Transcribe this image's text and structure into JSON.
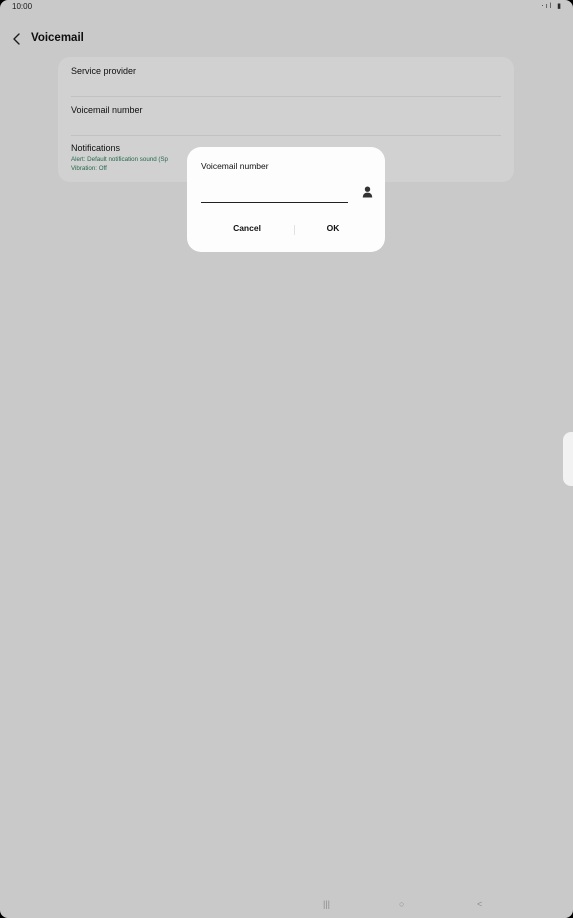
{
  "status_bar": {
    "time": "10:00",
    "icons": "⋅ıl ▮"
  },
  "app_bar": {
    "title": "Voicemail",
    "back_icon": "chevron-left-icon"
  },
  "settings": {
    "service_provider": "Service provider",
    "voicemail_number": "Voicemail number",
    "notifications": {
      "label": "Notifications",
      "alert": "Alert: Default notification sound (Sp",
      "vibration": "Vibration: Off"
    }
  },
  "dialog": {
    "title": "Voicemail number",
    "input_value": "",
    "contact_icon": "contact-person-icon",
    "cancel_label": "Cancel",
    "ok_label": "OK"
  },
  "nav_bar": {
    "recents": "|||",
    "home": "○",
    "back": "<"
  },
  "colors": {
    "accent_green": "#2e7d5b",
    "scrim": "rgba(0,0,0,0.17)"
  }
}
